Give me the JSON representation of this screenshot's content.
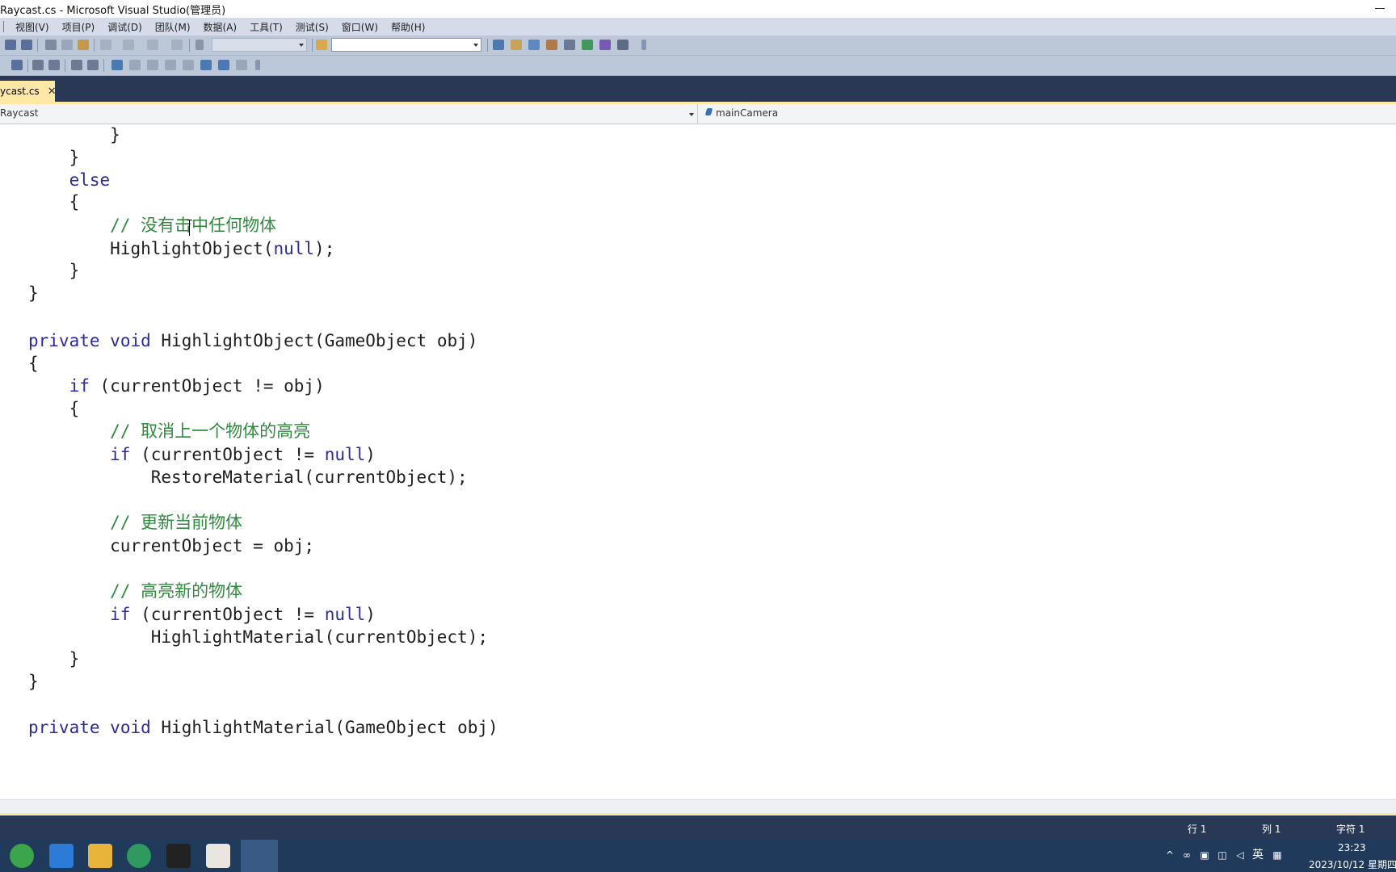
{
  "window": {
    "title": "Raycast.cs - Microsoft Visual Studio(管理员)"
  },
  "menu": {
    "items": [
      "视图(V)",
      "项目(P)",
      "调试(D)",
      "团队(M)",
      "数据(A)",
      "工具(T)",
      "测试(S)",
      "窗口(W)",
      "帮助(H)"
    ]
  },
  "tab": {
    "label": "ycast.cs",
    "close": "✕"
  },
  "navigation": {
    "class_selector": "Raycast",
    "member_selector": "mainCamera"
  },
  "code": {
    "lines": [
      "        }",
      "    }",
      "    else",
      "    {",
      "        // 没有击中任何物体",
      "        HighlightObject(null);",
      "    }",
      "}",
      "",
      "private void HighlightObject(GameObject obj)",
      "{",
      "    if (currentObject != obj)",
      "    {",
      "        // 取消上一个物体的高亮",
      "        if (currentObject != null)",
      "            RestoreMaterial(currentObject);",
      "",
      "        // 更新当前物体",
      "        currentObject = obj;",
      "",
      "        // 高亮新的物体",
      "        if (currentObject != null)",
      "            HighlightMaterial(currentObject);",
      "    }",
      "}",
      "",
      "private void HighlightMaterial(GameObject obj)"
    ]
  },
  "status": {
    "line": "行 1",
    "col": "列 1",
    "char": "字符 1"
  },
  "taskbar": {
    "ime": "英",
    "time": "23:23",
    "date": "2023/10/12 星期四"
  },
  "colors": {
    "keyword": "#2a2aa5",
    "comment": "#2e8b3e",
    "chrome_dark": "#293955",
    "tab_active": "#ffe8a6"
  }
}
